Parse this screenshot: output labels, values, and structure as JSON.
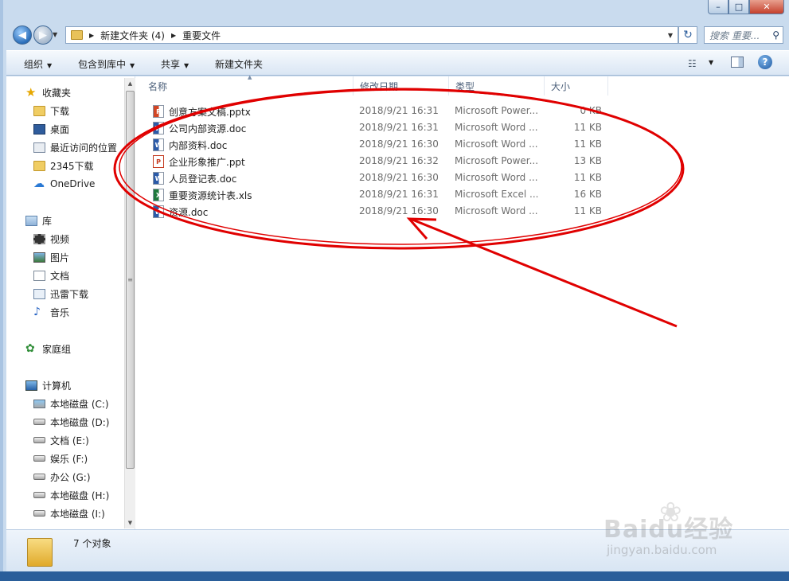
{
  "window": {
    "caption": {
      "minimize": "–",
      "maximize": "□",
      "close": "✕"
    }
  },
  "address": {
    "back_glyph": "◀",
    "forward_glyph": "▶",
    "dropdown_glyph": "▼",
    "sep_glyph": "▶",
    "breadcrumb": [
      "新建文件夹 (4)",
      "重要文件"
    ],
    "refresh_glyph": "↻",
    "search_placeholder": "搜索 重要...",
    "search_icon": "⚲"
  },
  "toolbar": {
    "organize": "组织",
    "include_in_library": "包含到库中",
    "share": "共享",
    "new_folder": "新建文件夹",
    "arrow": "▼",
    "view_icon": "☷",
    "help": "?"
  },
  "nav": {
    "favorites": "收藏夹",
    "download": "下载",
    "desktop": "桌面",
    "recent": "最近访问的位置",
    "dl2345": "2345下载",
    "onedrive": "OneDrive",
    "libraries": "库",
    "videos": "视频",
    "pictures": "图片",
    "documents": "文档",
    "thunder": "迅雷下载",
    "music": "音乐",
    "homegroup": "家庭组",
    "computer": "计算机",
    "drives": [
      "本地磁盘 (C:)",
      "本地磁盘 (D:)",
      "文档 (E:)",
      "娱乐 (F:)",
      "办公 (G:)",
      "本地磁盘 (H:)",
      "本地磁盘 (I:)"
    ]
  },
  "columns": {
    "name": "名称",
    "date": "修改日期",
    "type": "类型",
    "size": "大小"
  },
  "files": [
    {
      "name": "创意方案文稿.pptx",
      "date": "2018/9/21 16:31",
      "type": "Microsoft Power...",
      "size": "0 KB",
      "kind": "ppt"
    },
    {
      "name": "公司内部资源.doc",
      "date": "2018/9/21 16:31",
      "type": "Microsoft Word ...",
      "size": "11 KB",
      "kind": "word"
    },
    {
      "name": "内部资料.doc",
      "date": "2018/9/21 16:30",
      "type": "Microsoft Word ...",
      "size": "11 KB",
      "kind": "word"
    },
    {
      "name": "企业形象推广.ppt",
      "date": "2018/9/21 16:32",
      "type": "Microsoft Power...",
      "size": "13 KB",
      "kind": "pptold"
    },
    {
      "name": "人员登记表.doc",
      "date": "2018/9/21 16:30",
      "type": "Microsoft Word ...",
      "size": "11 KB",
      "kind": "word"
    },
    {
      "name": "重要资源统计表.xls",
      "date": "2018/9/21 16:31",
      "type": "Microsoft Excel ...",
      "size": "16 KB",
      "kind": "xls"
    },
    {
      "name": "资源.doc",
      "date": "2018/9/21 16:30",
      "type": "Microsoft Word ...",
      "size": "11 KB",
      "kind": "word"
    }
  ],
  "status": {
    "count": "7 个对象"
  },
  "watermark": {
    "brand": "Baidu经验",
    "url": "jingyan.baidu.com"
  },
  "colors": {
    "annotation": "#e00000",
    "accent": "#2a6fb8"
  }
}
